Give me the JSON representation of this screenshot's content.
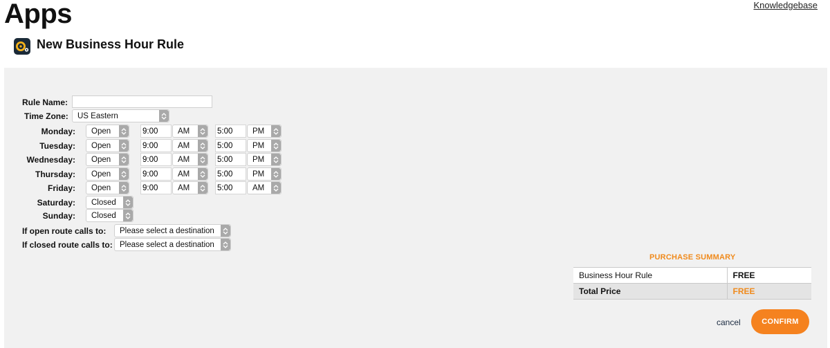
{
  "header": {
    "title": "Apps",
    "knowledgebase_link": "Knowledgebase",
    "page_title": "New Business Hour Rule",
    "app_icon": "record-disc-icon"
  },
  "form": {
    "rule_name_label": "Rule Name:",
    "rule_name_value": "",
    "time_zone_label": "Time Zone:",
    "time_zone_value": "US Eastern",
    "days": [
      {
        "label": "Monday:",
        "status": "Open",
        "open_time": "9:00",
        "open_ampm": "AM",
        "close_time": "5:00",
        "close_ampm": "PM"
      },
      {
        "label": "Tuesday:",
        "status": "Open",
        "open_time": "9:00",
        "open_ampm": "AM",
        "close_time": "5:00",
        "close_ampm": "PM"
      },
      {
        "label": "Wednesday:",
        "status": "Open",
        "open_time": "9:00",
        "open_ampm": "AM",
        "close_time": "5:00",
        "close_ampm": "PM"
      },
      {
        "label": "Thursday:",
        "status": "Open",
        "open_time": "9:00",
        "open_ampm": "AM",
        "close_time": "5:00",
        "close_ampm": "PM"
      },
      {
        "label": "Friday:",
        "status": "Open",
        "open_time": "9:00",
        "open_ampm": "AM",
        "close_time": "5:00",
        "close_ampm": "AM"
      },
      {
        "label": "Saturday:",
        "status": "Closed"
      },
      {
        "label": "Sunday:",
        "status": "Closed"
      }
    ],
    "open_route_label": "If open route calls to:",
    "open_route_value": "Please select a destination",
    "closed_route_label": "If closed route calls to:",
    "closed_route_value": "Please select a destination"
  },
  "summary": {
    "title": "PURCHASE SUMMARY",
    "rows": [
      {
        "item": "Business Hour Rule",
        "price": "FREE"
      },
      {
        "item": "Total Price",
        "price": "FREE"
      }
    ],
    "accent_color": "#f5821f"
  },
  "actions": {
    "cancel_label": "cancel",
    "confirm_label": "CONFIRM"
  }
}
